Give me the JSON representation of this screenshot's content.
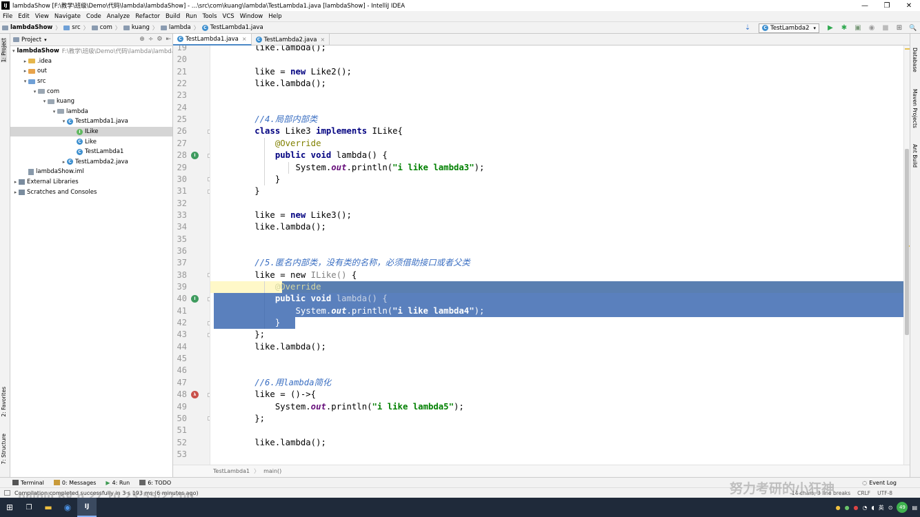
{
  "window": {
    "title": "lambdaShow [F:\\教学\\班级\\Demo\\代码\\lambda\\lambdaShow] - ...\\src\\com\\kuang\\lambda\\TestLambda1.java [lambdaShow] - IntelliJ IDEA",
    "app_icon_text": "IJ",
    "min": "—",
    "max": "❐",
    "close": "✕"
  },
  "menu": [
    "File",
    "Edit",
    "View",
    "Navigate",
    "Code",
    "Analyze",
    "Refactor",
    "Build",
    "Run",
    "Tools",
    "VCS",
    "Window",
    "Help"
  ],
  "breadcrumb": [
    "lambdaShow",
    "src",
    "com",
    "kuang",
    "lambda",
    "TestLambda1.java"
  ],
  "run_config": "TestLambda2",
  "toolbar_icons": {
    "run": "▶",
    "debug": "✱",
    "coverage": "▣",
    "profile": "◉",
    "stop": "■",
    "structure": "⊞",
    "search": "🔍"
  },
  "left_tabs": {
    "project": "1: Project",
    "favorites": "2: Favorites",
    "structure": "7: Structure"
  },
  "right_tabs": {
    "database": "Database",
    "maven": "Maven Projects",
    "ant": "Ant Build"
  },
  "project_panel": {
    "header": "Project",
    "tree": [
      {
        "label": "lambdaShow",
        "note": "F:\\教学\\班级\\Demo\\代码\\lambda\\lambdaShow",
        "indent": 0,
        "arrow": "▾",
        "icon": "folder-gray",
        "bold": true
      },
      {
        "label": ".idea",
        "indent": 1,
        "arrow": "▸",
        "icon": "folder-yellow"
      },
      {
        "label": "out",
        "indent": 1,
        "arrow": "▸",
        "icon": "folder-orange"
      },
      {
        "label": "src",
        "indent": 1,
        "arrow": "▾",
        "icon": "folder-blue"
      },
      {
        "label": "com",
        "indent": 2,
        "arrow": "▾",
        "icon": "folder-gray"
      },
      {
        "label": "kuang",
        "indent": 3,
        "arrow": "▾",
        "icon": "folder-gray"
      },
      {
        "label": "lambda",
        "indent": 4,
        "arrow": "▾",
        "icon": "folder-gray"
      },
      {
        "label": "TestLambda1.java",
        "indent": 5,
        "arrow": "▾",
        "icon": "class"
      },
      {
        "label": "ILike",
        "indent": 6,
        "arrow": "",
        "icon": "interface",
        "selected": true
      },
      {
        "label": "Like",
        "indent": 6,
        "arrow": "",
        "icon": "class"
      },
      {
        "label": "TestLambda1",
        "indent": 6,
        "arrow": "",
        "icon": "class"
      },
      {
        "label": "TestLambda2.java",
        "indent": 5,
        "arrow": "▸",
        "icon": "class"
      },
      {
        "label": "lambdaShow.iml",
        "indent": 1,
        "arrow": "",
        "icon": "iml"
      },
      {
        "label": "External Libraries",
        "indent": 0,
        "arrow": "▸",
        "icon": "lib"
      },
      {
        "label": "Scratches and Consoles",
        "indent": 0,
        "arrow": "▸",
        "icon": "lib"
      }
    ]
  },
  "editor_tabs": [
    {
      "label": "TestLambda1.java",
      "active": true
    },
    {
      "label": "TestLambda2.java",
      "active": false
    }
  ],
  "code_lines": [
    {
      "n": "19",
      "html": "        like.lambda();"
    },
    {
      "n": "20",
      "html": ""
    },
    {
      "n": "21",
      "html": "        like = <span class=\"kw\">new</span> Like2();"
    },
    {
      "n": "22",
      "html": "        like.lambda();"
    },
    {
      "n": "23",
      "html": ""
    },
    {
      "n": "24",
      "html": ""
    },
    {
      "n": "25",
      "html": "        <span class=\"cmt\">//4.局部内部类</span>"
    },
    {
      "n": "26",
      "html": "        <span class=\"kw\">class</span> Like3 <span class=\"kw\">implements</span> ILike{"
    },
    {
      "n": "27",
      "html": "            <span class=\"ann\">@Override</span>"
    },
    {
      "n": "28",
      "html": "            <span class=\"kw\">public void</span> lambda() {"
    },
    {
      "n": "29",
      "html": "                System.<span class=\"fld\">out</span>.println(<span class=\"str\">\"i like lambda3\"</span>);"
    },
    {
      "n": "30",
      "html": "            }"
    },
    {
      "n": "31",
      "html": "        }"
    },
    {
      "n": "32",
      "html": ""
    },
    {
      "n": "33",
      "html": "        like = <span class=\"kw\">new</span> Like3();"
    },
    {
      "n": "34",
      "html": "        like.lambda();"
    },
    {
      "n": "35",
      "html": ""
    },
    {
      "n": "36",
      "html": ""
    },
    {
      "n": "37",
      "html": "        <span class=\"cmt\">//5.匿名内部类，没有类的名称，必须借助接口或者父类</span>"
    },
    {
      "n": "38",
      "html": "        like = new <span class=\"gry\">ILike()</span> {"
    },
    {
      "n": "39",
      "html": "            <span class=\"ann\">@Override</span>"
    },
    {
      "n": "40",
      "html": "            <span class=\"kw\">public void</span> <span class=\"gry\">lambda() {</span>"
    },
    {
      "n": "41",
      "html": "                System.<span class=\"fld\">out</span>.println(<span class=\"str\">\"i like lambda4\"</span>);"
    },
    {
      "n": "42",
      "html": "            }"
    },
    {
      "n": "43",
      "html": "        };"
    },
    {
      "n": "44",
      "html": "        like.lambda();"
    },
    {
      "n": "45",
      "html": ""
    },
    {
      "n": "46",
      "html": ""
    },
    {
      "n": "47",
      "html": "        <span class=\"cmt\">//6.用lambda简化</span>"
    },
    {
      "n": "48",
      "html": "        like = ()-&gt;{"
    },
    {
      "n": "49",
      "html": "            System.<span class=\"fld\">out</span>.println(<span class=\"str\">\"i like lambda5\"</span>);"
    },
    {
      "n": "50",
      "html": "        };"
    },
    {
      "n": "51",
      "html": ""
    },
    {
      "n": "52",
      "html": "        like.lambda();"
    },
    {
      "n": "53",
      "html": ""
    }
  ],
  "gutter_marks": [
    {
      "line": "28",
      "type": "impl"
    },
    {
      "line": "40",
      "type": "impl"
    },
    {
      "line": "48",
      "type": "lambda"
    }
  ],
  "editor_breadcrumb": [
    "TestLambda1",
    "main()"
  ],
  "tool_windows": [
    {
      "label": "Terminal",
      "color": "#555555"
    },
    {
      "label": "0: Messages",
      "color": "#c89a3a"
    },
    {
      "label": "4: Run",
      "color": "#3d9a52"
    },
    {
      "label": "6: TODO",
      "color": "#666666"
    }
  ],
  "event_log": "Event Log",
  "status": {
    "message": "Compilation completed successfully in 3 s 193 ms (6 minutes ago)",
    "right": [
      "14 chars, 3 line breaks",
      "CRLF",
      "UTF-8"
    ]
  },
  "watermarks": {
    "top": "努力考研的小狂神",
    "bottom": "bilibili BV p.27 10 23:55/27:00"
  },
  "taskbar": {
    "start": "⊞",
    "taskview": "❐",
    "explorer": "▬",
    "browser": "◉",
    "idea": "IJ",
    "tray_badge": "49",
    "tray_lang": "英"
  }
}
